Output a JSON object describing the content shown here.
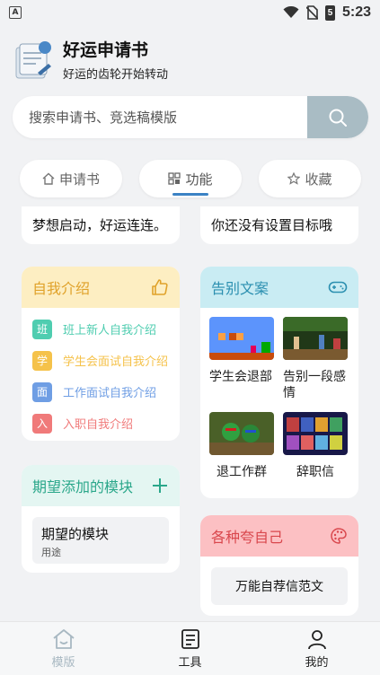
{
  "status": {
    "app_indicator": "A",
    "time": "5:23",
    "battery_text": "5"
  },
  "header": {
    "title": "好运申请书",
    "subtitle": "好运的齿轮开始转动"
  },
  "search": {
    "placeholder": "搜索申请书、竞选稿模版"
  },
  "tabs": [
    {
      "label": "申请书",
      "icon": "home-icon",
      "active": false
    },
    {
      "label": "功能",
      "icon": "grid-icon",
      "active": true
    },
    {
      "label": "收藏",
      "icon": "star-icon",
      "active": false
    }
  ],
  "goals": {
    "left": "梦想启动，好运连连。",
    "right": "你还没有设置目标哦"
  },
  "intro": {
    "title": "自我介绍",
    "header_color": "#fdeec2",
    "title_color": "#e0a22a",
    "items": [
      {
        "badge": "班",
        "label": "班上新人自我介绍",
        "color": "#4fcdb0"
      },
      {
        "badge": "学",
        "label": "学生会面试自我介绍",
        "color": "#f5c24a"
      },
      {
        "badge": "面",
        "label": "工作面试自我介绍",
        "color": "#6f9ee4"
      },
      {
        "badge": "入",
        "label": "入职自我介绍",
        "color": "#f07a7a"
      }
    ]
  },
  "farewell": {
    "title": "告别文案",
    "header_color": "#c9ecf3",
    "title_color": "#2b8fb0",
    "items": [
      {
        "label": "学生会退部"
      },
      {
        "label": "告别一段感情"
      },
      {
        "label": "退工作群"
      },
      {
        "label": "辞职信"
      }
    ]
  },
  "modules": {
    "title": "期望添加的模块",
    "header_color": "#e4f6f2",
    "title_color": "#2aa78a",
    "item": {
      "title": "期望的模块",
      "subtitle": "用途"
    }
  },
  "praise": {
    "title": "各种夸自己",
    "header_color": "#fcc0c3",
    "title_color": "#d9474d",
    "item": "万能自荐信范文"
  },
  "nav": [
    {
      "label": "模版",
      "icon": "house-icon",
      "active": false
    },
    {
      "label": "工具",
      "icon": "document-icon",
      "active": true
    },
    {
      "label": "我的",
      "icon": "user-icon",
      "active": true
    }
  ]
}
